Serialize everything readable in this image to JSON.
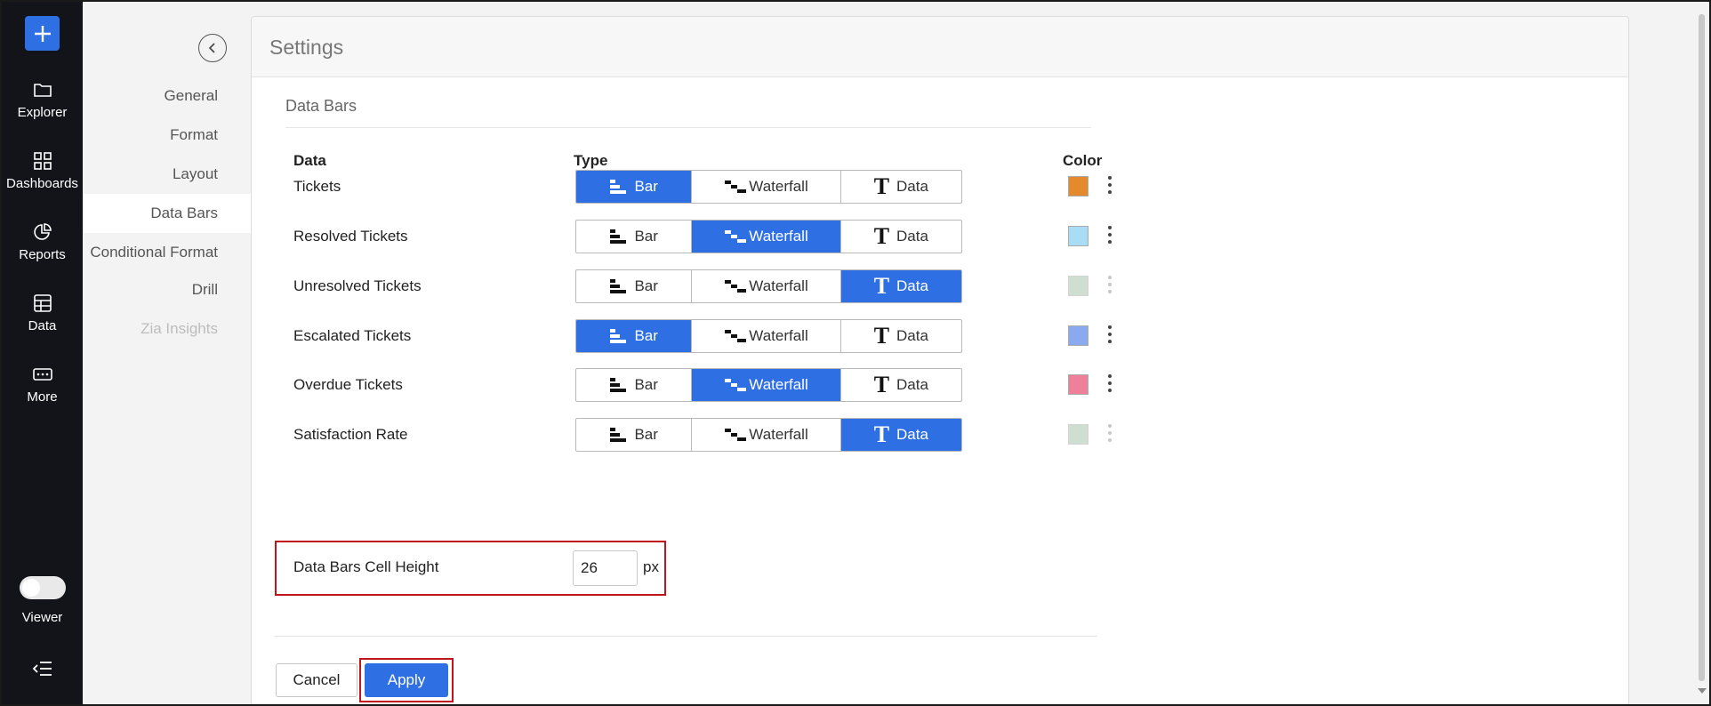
{
  "rail": {
    "items": [
      {
        "label": "Explorer",
        "icon": "folder-icon"
      },
      {
        "label": "Dashboards",
        "icon": "grid-icon"
      },
      {
        "label": "Reports",
        "icon": "pie-chart-icon"
      },
      {
        "label": "Data",
        "icon": "table-icon"
      },
      {
        "label": "More",
        "icon": "more-icon"
      }
    ],
    "viewer_label": "Viewer",
    "accent": "#2f6fe4"
  },
  "subnav": {
    "items": [
      {
        "label": "General",
        "state": "normal"
      },
      {
        "label": "Format",
        "state": "normal"
      },
      {
        "label": "Layout",
        "state": "normal"
      },
      {
        "label": "Data Bars",
        "state": "active"
      },
      {
        "label": "Conditional Format",
        "state": "normal"
      },
      {
        "label": "Drill",
        "state": "normal"
      },
      {
        "label": "Zia Insights",
        "state": "disabled"
      }
    ]
  },
  "panel": {
    "title": "Settings",
    "section_title": "Data Bars",
    "columns": {
      "data": "Data",
      "type": "Type",
      "color": "Color"
    },
    "type_options": [
      "Bar",
      "Waterfall",
      "Data"
    ],
    "rows": [
      {
        "label": "Tickets",
        "selected": "Bar",
        "color": "#e58a2c",
        "color_enabled": true
      },
      {
        "label": "Resolved Tickets",
        "selected": "Waterfall",
        "color": "#a9dcf5",
        "color_enabled": true
      },
      {
        "label": "Unresolved Tickets",
        "selected": "Data",
        "color": "#c9dccd",
        "color_enabled": false
      },
      {
        "label": "Escalated Tickets",
        "selected": "Bar",
        "color": "#8aa9ee",
        "color_enabled": true
      },
      {
        "label": "Overdue Tickets",
        "selected": "Waterfall",
        "color": "#ef8099",
        "color_enabled": true
      },
      {
        "label": "Satisfaction Rate",
        "selected": "Data",
        "color": "#c9dccd",
        "color_enabled": false
      }
    ],
    "cell_height": {
      "label": "Data Bars Cell Height",
      "value": "26",
      "unit": "px"
    },
    "buttons": {
      "cancel": "Cancel",
      "apply": "Apply"
    }
  }
}
